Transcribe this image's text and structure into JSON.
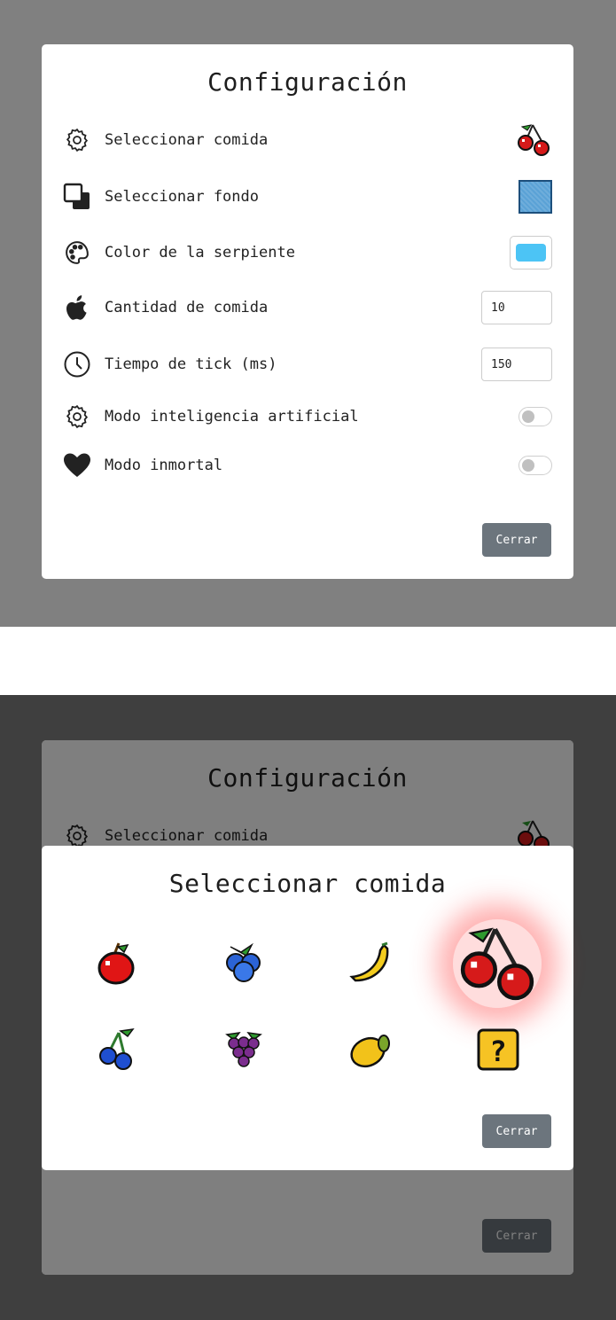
{
  "settings": {
    "title": "Configuración",
    "rows": [
      {
        "label": "Seleccionar comida",
        "icon": "gear-icon",
        "control": "food-preview",
        "value_icon": "cherries-icon"
      },
      {
        "label": "Seleccionar fondo",
        "icon": "layers-icon",
        "control": "background-swatch"
      },
      {
        "label": "Color de la serpiente",
        "icon": "palette-icon",
        "control": "color-picker",
        "color": "#4cc4f5"
      },
      {
        "label": "Cantidad de comida",
        "icon": "apple-icon",
        "control": "number",
        "value": "10"
      },
      {
        "label": "Tiempo de tick (ms)",
        "icon": "clock-icon",
        "control": "number",
        "value": "150"
      },
      {
        "label": "Modo inteligencia artificial",
        "icon": "gear-icon",
        "control": "toggle",
        "on": false
      },
      {
        "label": "Modo inmortal",
        "icon": "heart-icon",
        "control": "toggle",
        "on": false
      }
    ],
    "close_label": "Cerrar"
  },
  "food_selector": {
    "title": "Seleccionar comida",
    "items": [
      {
        "icon": "apple-icon",
        "selected": false
      },
      {
        "icon": "blueberries-icon",
        "selected": false
      },
      {
        "icon": "banana-icon",
        "selected": false
      },
      {
        "icon": "cherries-icon",
        "selected": true
      },
      {
        "icon": "blue-cherries-icon",
        "selected": false
      },
      {
        "icon": "grapes-icon",
        "selected": false
      },
      {
        "icon": "mango-icon",
        "selected": false
      },
      {
        "icon": "mystery-box-icon",
        "selected": false
      }
    ],
    "close_label": "Cerrar"
  },
  "colors": {
    "overlay_top": "#808080",
    "overlay_bottom": "#3f3f3f",
    "button": "#6c757d",
    "snake_color": "#4cc4f5"
  }
}
